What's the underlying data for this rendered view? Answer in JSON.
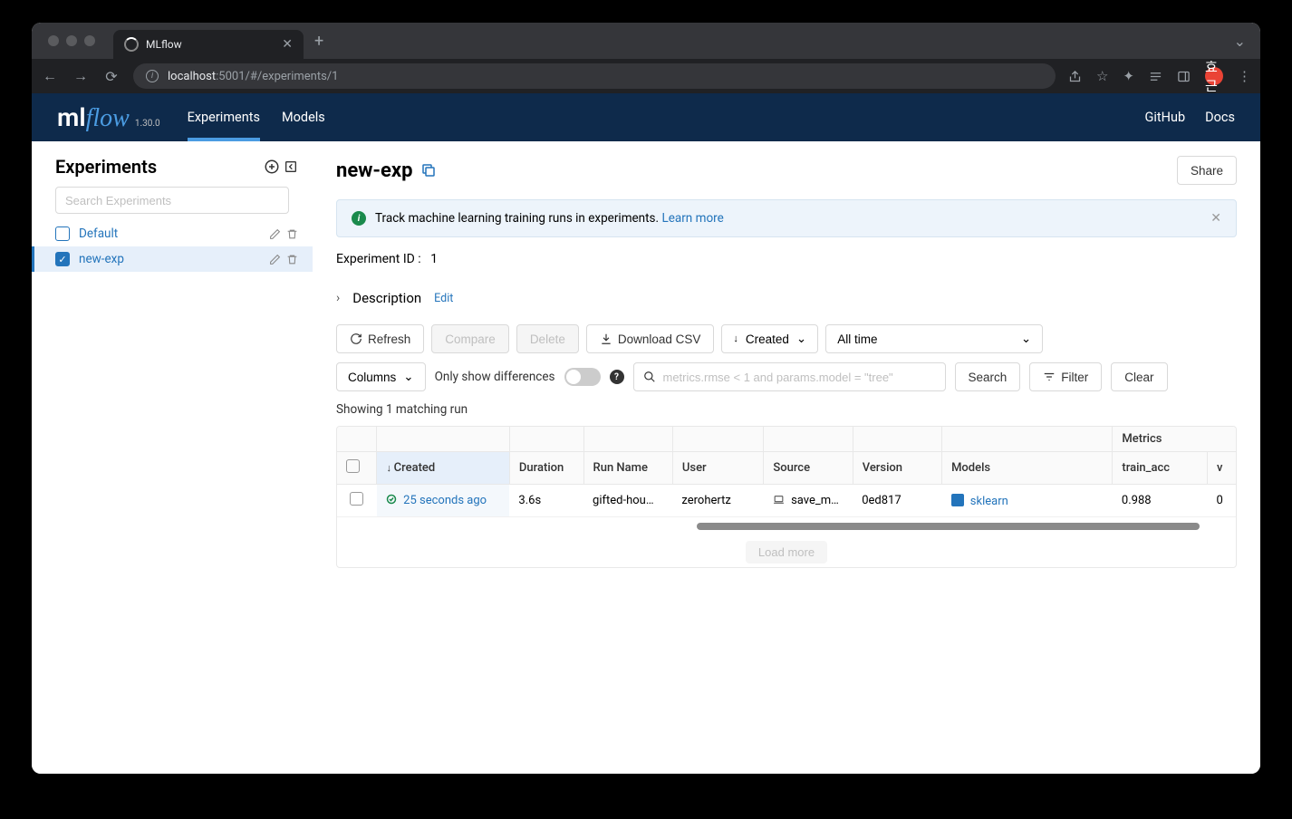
{
  "browser": {
    "tab_title": "MLflow",
    "url_host": "localhost",
    "url_path": ":5001/#/experiments/1",
    "avatar": "효근"
  },
  "header": {
    "logo_ml": "ml",
    "logo_flow": "flow",
    "version": "1.30.0",
    "nav": {
      "experiments": "Experiments",
      "models": "Models"
    },
    "right": {
      "github": "GitHub",
      "docs": "Docs"
    }
  },
  "sidebar": {
    "title": "Experiments",
    "search_placeholder": "Search Experiments",
    "items": [
      {
        "name": "Default",
        "checked": false
      },
      {
        "name": "new-exp",
        "checked": true
      }
    ]
  },
  "main": {
    "title": "new-exp",
    "share_label": "Share",
    "banner": {
      "text": "Track machine learning training runs in experiments.",
      "link": "Learn more"
    },
    "experiment_id_label": "Experiment ID",
    "experiment_id": "1",
    "description_label": "Description",
    "edit_label": "Edit",
    "toolbar": {
      "refresh": "Refresh",
      "compare": "Compare",
      "delete": "Delete",
      "download_csv": "Download CSV",
      "sort": "Created",
      "time_filter": "All time",
      "columns": "Columns",
      "only_diff": "Only show differences",
      "search_placeholder": "metrics.rmse < 1 and params.model = \"tree\"",
      "search": "Search",
      "filter": "Filter",
      "clear": "Clear"
    },
    "result_count": "Showing 1 matching run",
    "table": {
      "group_metrics": "Metrics",
      "headers": {
        "created": "Created",
        "duration": "Duration",
        "run_name": "Run Name",
        "user": "User",
        "source": "Source",
        "version": "Version",
        "models": "Models",
        "train_acc": "train_acc",
        "v": "v"
      },
      "rows": [
        {
          "created": "25 seconds ago",
          "duration": "3.6s",
          "run_name": "gifted-hou…",
          "user": "zerohertz",
          "source": "save_m…",
          "version": "0ed817",
          "models": "sklearn",
          "train_acc": "0.988",
          "v": "0"
        }
      ]
    },
    "load_more": "Load more"
  }
}
